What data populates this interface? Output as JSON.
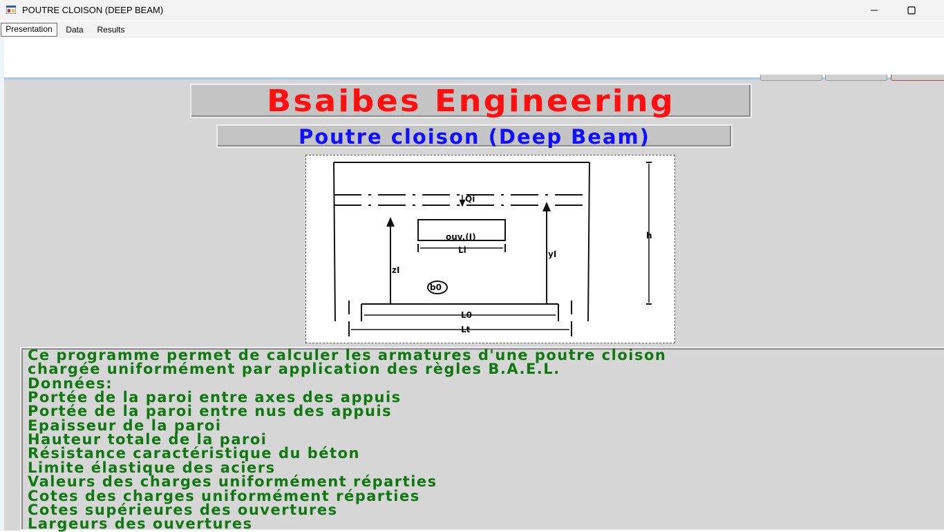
{
  "window": {
    "title": "POUTRE CLOISON (DEEP BEAM)"
  },
  "tabs": [
    {
      "label": "Presentation",
      "active": true
    },
    {
      "label": "Data",
      "active": false
    },
    {
      "label": "Results",
      "active": false
    }
  ],
  "heading": "Bsaibes Engineering",
  "subheading": "Poutre cloison (Deep Beam)",
  "diagram": {
    "labels": {
      "qi": "Qi",
      "opening": "ouv.(I)",
      "li": "Li",
      "yi": "yI",
      "h": "h",
      "zi": "zI",
      "b0": "b0",
      "l0": "L0",
      "lt": "Lt"
    }
  },
  "description": [
    "Ce programme permet de calculer les armatures d'une poutre cloison",
    "chargée uniformément par application des règles B.A.E.L.",
    "Données:",
    "Portée de la paroi entre axes des appuis",
    "Portée de la paroi entre nus des appuis",
    "Epaisseur de la paroi",
    "Hauteur totale de la paroi",
    "Résistance caractéristique du béton",
    "Limite élastique des aciers",
    "Valeurs des charges uniformément réparties",
    "Cotes des charges uniformément réparties",
    "Cotes supérieures des ouvertures",
    "Largeurs des ouvertures"
  ],
  "colors": {
    "heading": "#ff1010",
    "subheading": "#1010ff",
    "description": "#107810",
    "panel": "#d6d6d6"
  }
}
